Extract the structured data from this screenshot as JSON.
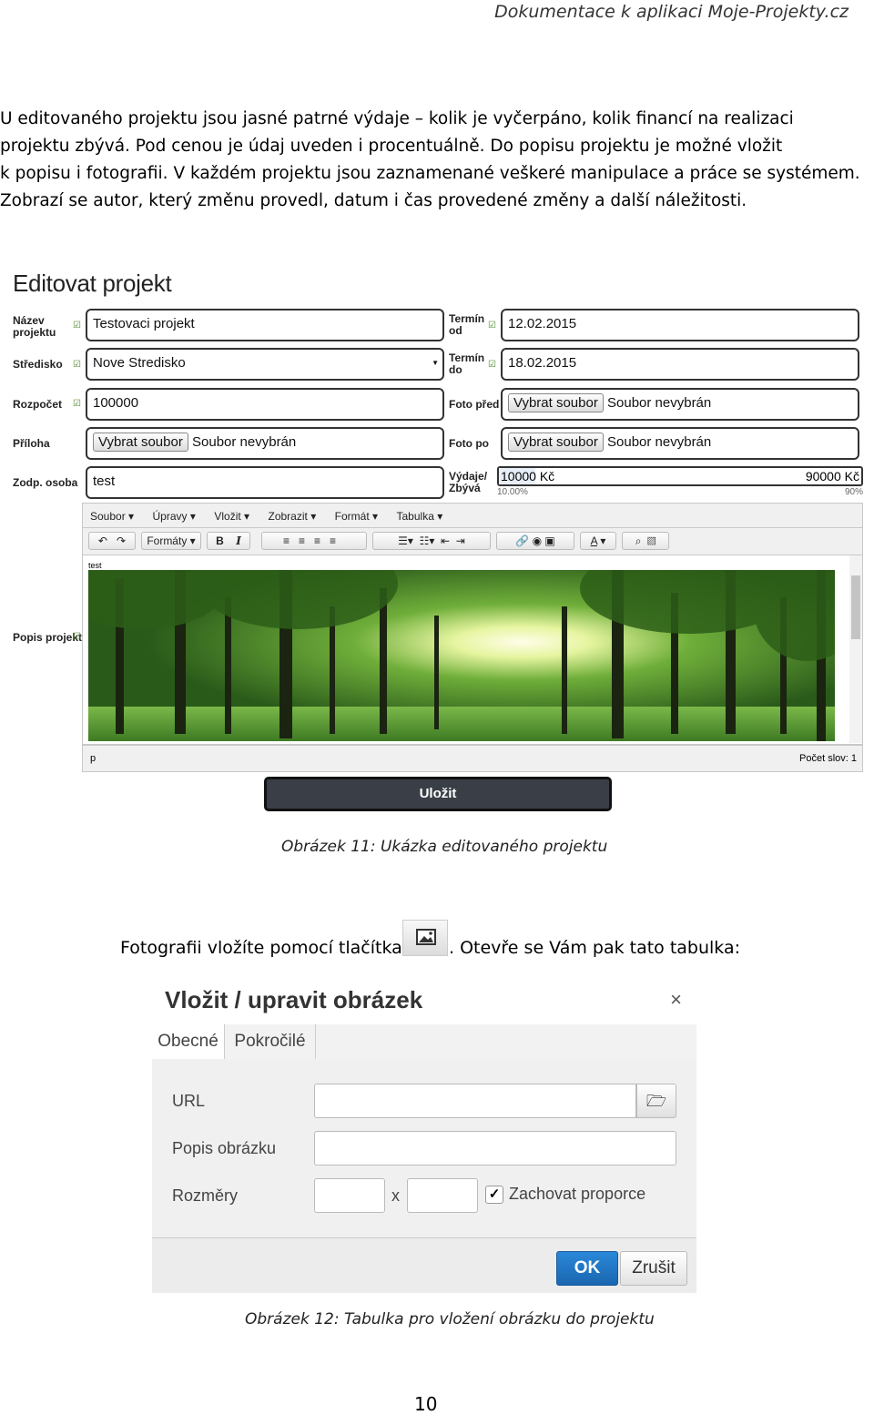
{
  "header": {
    "title": "Dokumentace k aplikaci Moje-Projekty.cz"
  },
  "paragraph": [
    "U editovaného projektu jsou jasné patrné výdaje – kolik je vyčerpáno, kolik financí na realizaci",
    "projektu zbývá. Pod cenou je údaj uveden i procentuálně. Do popisu projektu je možné vložit",
    "k popisu i fotografii. V každém projektu jsou zaznamenané veškeré manipulace a práce se systémem.",
    "Zobrazí se autor, který změnu provedl, datum i čas provedené změny a další náležitosti."
  ],
  "figure1": {
    "title": "Editovat projekt",
    "left_fields": [
      {
        "label": [
          "Název",
          "projektu"
        ],
        "value": "Testovaci projekt"
      },
      {
        "label": [
          "Středisko"
        ],
        "value": "Nove Stredisko"
      },
      {
        "label": [
          "Rozpočet"
        ],
        "value": "100000"
      },
      {
        "label": [
          "Příloha"
        ],
        "button": "Vybrat soubor",
        "value": "Soubor nevybrán"
      },
      {
        "label": [
          "Zodp. osoba"
        ],
        "value": "test"
      }
    ],
    "right_fields": [
      {
        "label": [
          "Termín",
          "od"
        ],
        "value": "12.02.2015"
      },
      {
        "label": [
          "Termín",
          "do"
        ],
        "value": "18.02.2015"
      },
      {
        "label": [
          "Foto před"
        ],
        "button": "Vybrat soubor",
        "value": "Soubor nevybrán"
      },
      {
        "label": [
          "Foto po"
        ],
        "button": "Vybrat soubor",
        "value": "Soubor nevybrán"
      }
    ],
    "expenses": {
      "label": [
        "Výdaje/",
        "Zbývá"
      ],
      "spent": "10000 Kč",
      "remaining": "90000 Kč",
      "spent_pct": "10.00%",
      "remaining_pct": "90%",
      "spent_fraction": 0.1
    },
    "menu": [
      "Soubor",
      "Úpravy",
      "Vložit",
      "Zobrazit",
      "Formát",
      "Tabulka"
    ],
    "toolbar": {
      "formats": "Formáty",
      "bold": "B",
      "italic": "I",
      "font_color": "A"
    },
    "description_label": "Popis projektu",
    "editor_text": "test",
    "status_path": "p",
    "word_count": "Počet slov: 1",
    "save": "Uložit"
  },
  "caption1": "Obrázek 11: Ukázka editovaného projektu",
  "sentence": {
    "before": "Fotografii vložíte pomocí tlačítka",
    "after": ". Otevře se Vám pak tato tabulka:"
  },
  "figure2": {
    "title": "Vložit / upravit obrázek",
    "close": "×",
    "tabs": [
      "Obecné",
      "Pokročilé"
    ],
    "url_label": "URL",
    "desc_label": "Popis obrázku",
    "size_label": "Rozměry",
    "size_sep": "x",
    "keep_ratio": "Zachovat proporce",
    "ok": "OK",
    "cancel": "Zrušit"
  },
  "caption2": "Obrázek 12: Tabulka pro vložení obrázku do projektu",
  "page_number": "10",
  "colors": {
    "save_button": "#3a3f47",
    "ok_button": "#1f77c8",
    "check_green": "#4a8a2a"
  },
  "icons": [
    "undo-icon",
    "redo-icon",
    "align-left-icon",
    "align-center-icon",
    "align-right-icon",
    "justify-icon",
    "bullet-list-icon",
    "numbered-list-icon",
    "outdent-icon",
    "indent-icon",
    "link-icon",
    "preview-icon",
    "media-icon",
    "search-replace-icon",
    "insert-image-icon",
    "browse-icon"
  ]
}
